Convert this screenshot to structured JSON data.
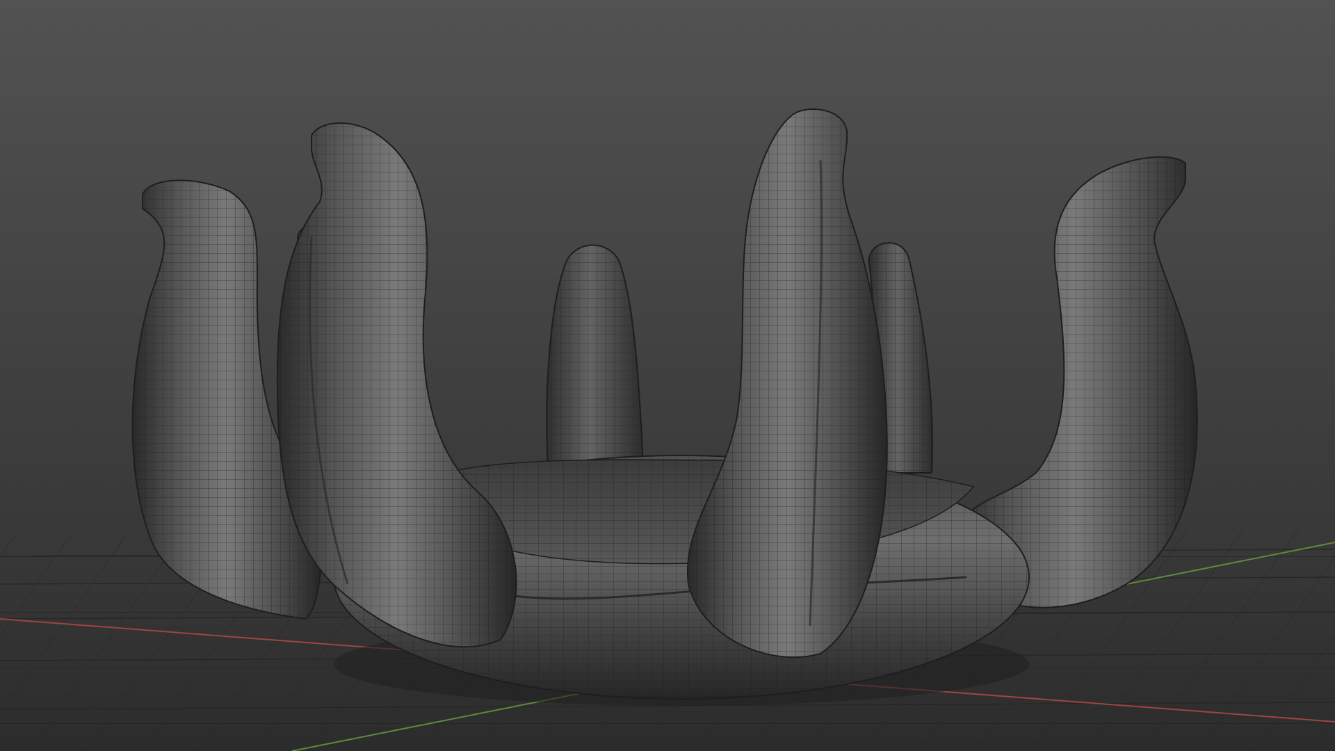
{
  "viewport": {
    "bg_top": "#545454",
    "bg_bottom": "#2b2b2b",
    "floor_color": "#333333",
    "grid_line": "#262626",
    "x_axis_color": "#b04848",
    "y_axis_color": "#6e9a3a"
  },
  "model": {
    "shade_light": "#8a8a8a",
    "shade_mid": "#5e5e5e",
    "shade_dark": "#262626",
    "wire_color": "#1c1c1c"
  }
}
